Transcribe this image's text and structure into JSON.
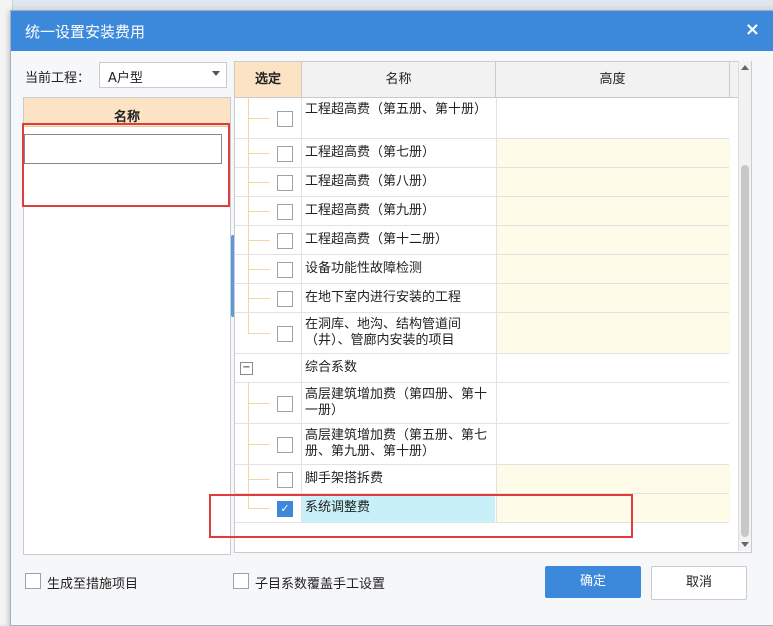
{
  "dialog": {
    "title": "统一设置安装费用",
    "close_label": "×"
  },
  "project": {
    "label": "当前工程：",
    "selected": "A户型"
  },
  "left_panel": {
    "header": "名称",
    "input_value": ""
  },
  "table": {
    "headers": {
      "select": "选定",
      "name": "名称",
      "height": "高度"
    },
    "rows": [
      {
        "name": "工程超高费（第五册、第十册）",
        "checked": false
      },
      {
        "name": "工程超高费（第七册）",
        "checked": false
      },
      {
        "name": "工程超高费（第八册）",
        "checked": false
      },
      {
        "name": "工程超高费（第九册）",
        "checked": false
      },
      {
        "name": "工程超高费（第十二册）",
        "checked": false
      },
      {
        "name": "设备功能性故障检测",
        "checked": false
      },
      {
        "name": "在地下室内进行安装的工程",
        "checked": false
      },
      {
        "name": "在洞库、地沟、结构管道间（井）、管廊内安装的项目",
        "checked": false
      },
      {
        "name": "综合系数",
        "group": true,
        "collapse_symbol": "−"
      },
      {
        "name": "高层建筑增加费（第四册、第十一册）",
        "checked": false
      },
      {
        "name": "高层建筑增加费（第五册、第七册、第九册、第十册）",
        "checked": false
      },
      {
        "name": "脚手架搭拆费",
        "checked": false
      },
      {
        "name": "系统调整费",
        "checked": true,
        "check_symbol": "✓"
      }
    ]
  },
  "bottom": {
    "generate_to_measures": "生成至措施项目",
    "override_manual": "子目系数覆盖手工设置",
    "ok_label": "确定",
    "cancel_label": "取消"
  },
  "colors": {
    "accent": "#3c89dc",
    "header_highlight": "#fbe3c4",
    "selected_row": "#c8f0f8",
    "annotation": "#e03c3c"
  }
}
